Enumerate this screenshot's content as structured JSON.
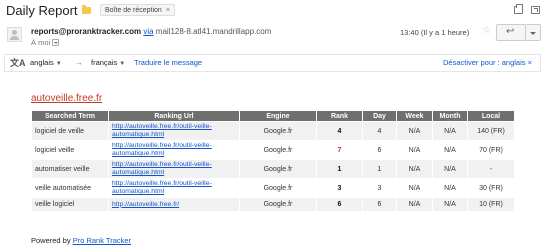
{
  "header": {
    "title": "Daily Report",
    "label_chip": "Boîte de réception",
    "label_close": "×"
  },
  "message": {
    "sender_email": "reports@proranktracker.com",
    "via_label": "via",
    "relay": "mail128-8.atl41.mandrillapp.com",
    "to_line": "À moi",
    "timestamp": "13:40 (Il y a 1 heure)",
    "star_glyph": "☆",
    "reply_glyph": "↩"
  },
  "translate": {
    "icon_text": "文A",
    "from_lang": "anglais",
    "arrow": "→",
    "to_lang": "français",
    "translate_link": "Traduire le message",
    "disable_link": "Désactiver pour : anglais ×"
  },
  "report": {
    "site": "autoveille.free.fr",
    "columns": [
      "Searched Term",
      "Ranking Url",
      "Engine",
      "Rank",
      "Day",
      "Week",
      "Month",
      "Local"
    ],
    "rows": [
      {
        "term": "logiciel de veille",
        "url1": "http://autoveille.free.fr/outil-veille-",
        "url2": "automatique.html",
        "engine": "Google.fr",
        "rank": "4",
        "day": "4",
        "week": "N/A",
        "month": "N/A",
        "local": "140 (FR)"
      },
      {
        "term": "logiciel veille",
        "url1": "http://autoveille.free.fr/outil-veille-",
        "url2": "automatique.html",
        "engine": "Google.fr",
        "rank": "7",
        "day": "6",
        "week": "N/A",
        "month": "N/A",
        "local": "70 (FR)"
      },
      {
        "term": "automatiser veille",
        "url1": "http://autoveille.free.fr/outil-veille-",
        "url2": "automatique.html",
        "engine": "Google.fr",
        "rank": "1",
        "day": "1",
        "week": "N/A",
        "month": "N/A",
        "local": "-"
      },
      {
        "term": "veille automatisée",
        "url1": "http://autoveille.free.fr/outil-veille-",
        "url2": "automatique.html",
        "engine": "Google.fr",
        "rank": "3",
        "day": "3",
        "week": "N/A",
        "month": "N/A",
        "local": "30 (FR)"
      },
      {
        "term": "veille logiciel",
        "url1": "http://autoveille.free.fr/",
        "url2": "",
        "engine": "Google.fr",
        "rank": "6",
        "day": "6",
        "week": "N/A",
        "month": "N/A",
        "local": "10 (FR)"
      }
    ],
    "rank_colors": {
      "up": "#d32f2f",
      "neutral": "#111111"
    }
  },
  "footer": {
    "prefix": "Powered by",
    "link": "Pro Rank Tracker"
  }
}
